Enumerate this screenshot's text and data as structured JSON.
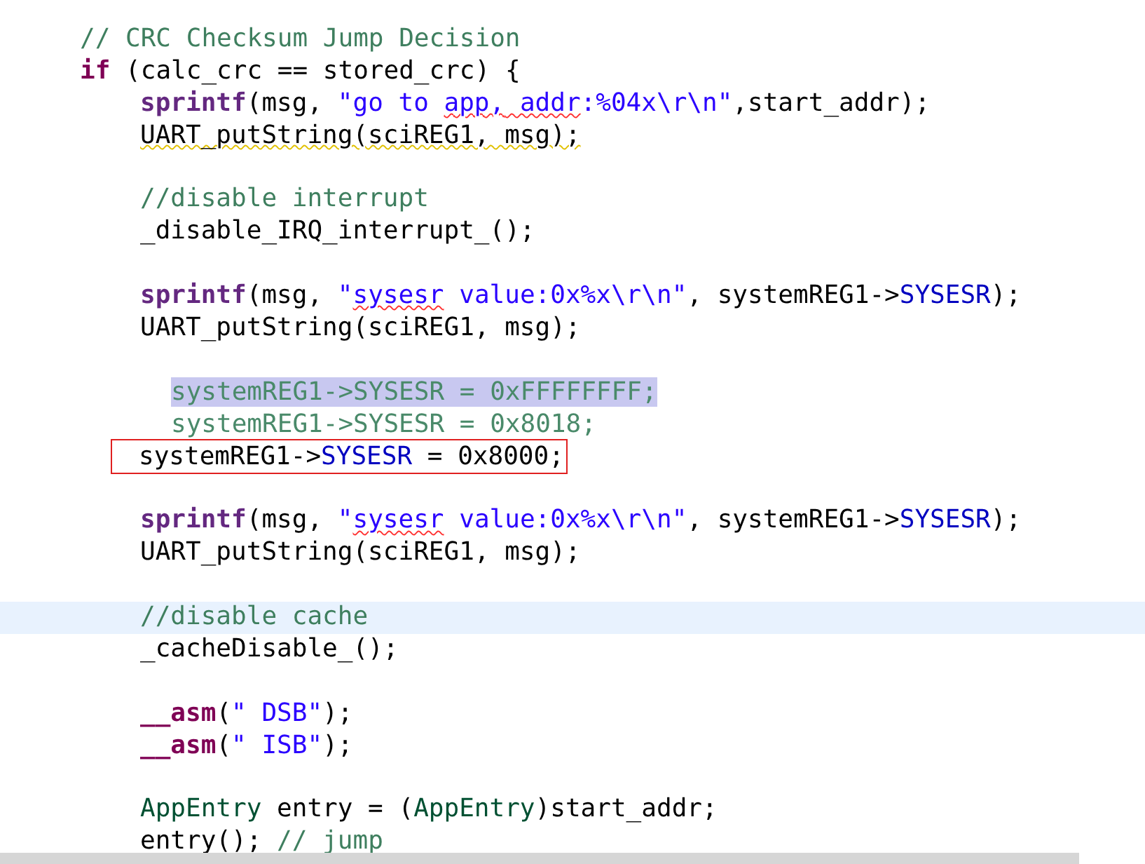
{
  "editor": {
    "lines": [
      {
        "kind": "outer",
        "current": false,
        "selected": false,
        "boxed": false,
        "tokens": [
          {
            "kind": "comment",
            "text": "// CRC Checksum Jump Decision"
          }
        ]
      },
      {
        "kind": "outer",
        "current": false,
        "selected": false,
        "boxed": false,
        "tokens": [
          {
            "kind": "keyword",
            "text": "if"
          },
          {
            "kind": "plain",
            "text": " (calc_crc == stored_crc) {"
          }
        ]
      },
      {
        "kind": "inner",
        "current": false,
        "selected": false,
        "boxed": false,
        "tokens": [
          {
            "kind": "func",
            "text": "sprintf"
          },
          {
            "kind": "plain",
            "text": "(msg, "
          },
          {
            "kind": "string",
            "text": "\"go to "
          },
          {
            "kind": "string",
            "text": "app,",
            "misspelled": true
          },
          {
            "kind": "string",
            "text": " addr",
            "misspelled": true
          },
          {
            "kind": "string",
            "text": ":%04x\\r\\n\""
          },
          {
            "kind": "plain",
            "text": ",start_addr);"
          }
        ]
      },
      {
        "kind": "inner",
        "current": false,
        "selected": false,
        "boxed": false,
        "tokens": [
          {
            "kind": "plain",
            "text": "UART_putString(sciREG1, msg);",
            "warned": true
          }
        ]
      },
      {
        "kind": "blank"
      },
      {
        "kind": "inner",
        "current": false,
        "selected": false,
        "boxed": false,
        "tokens": [
          {
            "kind": "comment",
            "text": "//disable interrupt"
          }
        ]
      },
      {
        "kind": "inner",
        "current": false,
        "selected": false,
        "boxed": false,
        "tokens": [
          {
            "kind": "plain",
            "text": "_disable_IRQ_interrupt_();"
          }
        ]
      },
      {
        "kind": "blank"
      },
      {
        "kind": "inner",
        "current": false,
        "selected": false,
        "boxed": false,
        "tokens": [
          {
            "kind": "func",
            "text": "sprintf"
          },
          {
            "kind": "plain",
            "text": "(msg, "
          },
          {
            "kind": "string",
            "text": "\""
          },
          {
            "kind": "string",
            "text": "sysesr",
            "misspelled": true
          },
          {
            "kind": "string",
            "text": " value:0x%x\\r\\n\""
          },
          {
            "kind": "plain",
            "text": ", systemREG1->"
          },
          {
            "kind": "field",
            "text": "SYSESR"
          },
          {
            "kind": "plain",
            "text": ");"
          }
        ]
      },
      {
        "kind": "inner",
        "current": false,
        "selected": false,
        "boxed": false,
        "tokens": [
          {
            "kind": "plain",
            "text": "UART_putString(sciREG1, msg);"
          }
        ]
      },
      {
        "kind": "blank"
      },
      {
        "kind": "deep",
        "current": false,
        "selected": true,
        "boxed": false,
        "tokens": [
          {
            "kind": "inactive",
            "text": "systemREG1->SYSESR = 0xFFFFFFFF;"
          }
        ]
      },
      {
        "kind": "deep",
        "current": false,
        "selected": false,
        "boxed": false,
        "tokens": [
          {
            "kind": "inactive",
            "text": "systemREG1->SYSESR = 0x8018;"
          }
        ]
      },
      {
        "kind": "inner",
        "current": false,
        "selected": false,
        "boxed": true,
        "tokens": [
          {
            "kind": "plain",
            "text": "systemREG1->"
          },
          {
            "kind": "field",
            "text": "SYSESR"
          },
          {
            "kind": "plain",
            "text": " = 0x8000;"
          }
        ]
      },
      {
        "kind": "blank"
      },
      {
        "kind": "inner",
        "current": false,
        "selected": false,
        "boxed": false,
        "tokens": [
          {
            "kind": "func",
            "text": "sprintf"
          },
          {
            "kind": "plain",
            "text": "(msg, "
          },
          {
            "kind": "string",
            "text": "\""
          },
          {
            "kind": "string",
            "text": "sysesr",
            "misspelled": true
          },
          {
            "kind": "string",
            "text": " value:0x%x\\r\\n\""
          },
          {
            "kind": "plain",
            "text": ", systemREG1->"
          },
          {
            "kind": "field",
            "text": "SYSESR"
          },
          {
            "kind": "plain",
            "text": ");"
          }
        ]
      },
      {
        "kind": "inner",
        "current": false,
        "selected": false,
        "boxed": false,
        "tokens": [
          {
            "kind": "plain",
            "text": "UART_putString(sciREG1, msg);"
          }
        ]
      },
      {
        "kind": "blank"
      },
      {
        "kind": "inner",
        "current": true,
        "selected": false,
        "boxed": false,
        "tokens": [
          {
            "kind": "comment",
            "text": "//disable cache"
          }
        ]
      },
      {
        "kind": "inner",
        "current": false,
        "selected": false,
        "boxed": false,
        "tokens": [
          {
            "kind": "plain",
            "text": "_cacheDisable_();"
          }
        ]
      },
      {
        "kind": "blank"
      },
      {
        "kind": "inner",
        "current": false,
        "selected": false,
        "boxed": false,
        "tokens": [
          {
            "kind": "keyword",
            "text": "__asm"
          },
          {
            "kind": "plain",
            "text": "("
          },
          {
            "kind": "string",
            "text": "\" DSB\""
          },
          {
            "kind": "plain",
            "text": ");"
          }
        ]
      },
      {
        "kind": "inner",
        "current": false,
        "selected": false,
        "boxed": false,
        "tokens": [
          {
            "kind": "keyword",
            "text": "__asm"
          },
          {
            "kind": "plain",
            "text": "("
          },
          {
            "kind": "string",
            "text": "\" ISB\""
          },
          {
            "kind": "plain",
            "text": ");"
          }
        ]
      },
      {
        "kind": "blank"
      },
      {
        "kind": "inner",
        "current": false,
        "selected": false,
        "boxed": false,
        "tokens": [
          {
            "kind": "type",
            "text": "AppEntry"
          },
          {
            "kind": "plain",
            "text": " entry = ("
          },
          {
            "kind": "type",
            "text": "AppEntry"
          },
          {
            "kind": "plain",
            "text": ")start_addr;"
          }
        ]
      },
      {
        "kind": "inner",
        "current": false,
        "selected": false,
        "boxed": false,
        "tokens": [
          {
            "kind": "plain",
            "text": "entry(); "
          },
          {
            "kind": "comment",
            "text": "// jump"
          }
        ]
      }
    ]
  }
}
